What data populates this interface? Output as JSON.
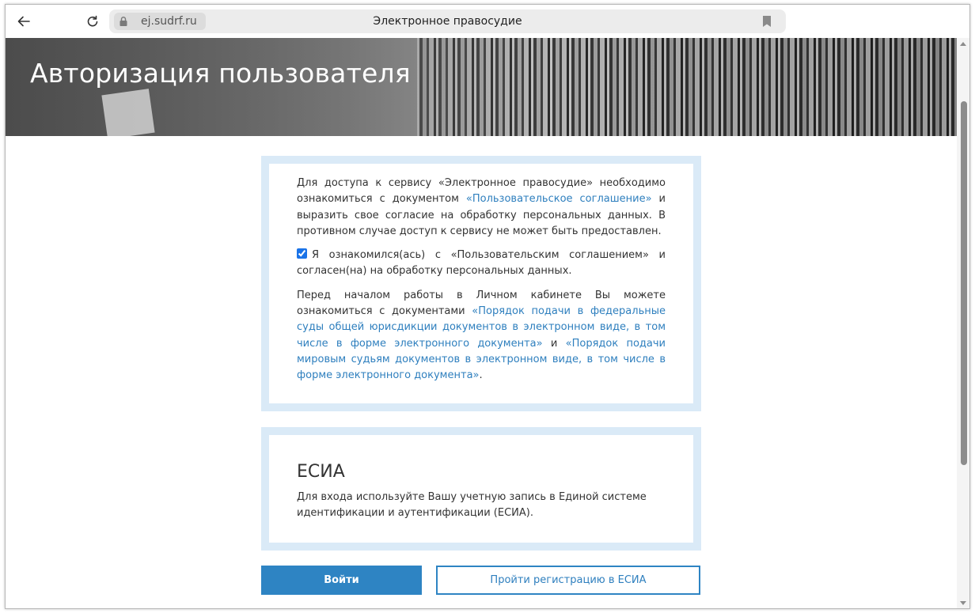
{
  "browser": {
    "domain": "ej.sudrf.ru",
    "tab_title": "Электронное правосудие"
  },
  "hero": {
    "title": "Авторизация пользователя"
  },
  "agreement": {
    "p1_part1": "Для доступа к сервису «Электронное правосудие» необходимо ознакомиться с документом ",
    "p1_link": "«Пользовательское соглашение»",
    "p1_part2": " и выразить свое согласие на обработку персональных данных. В противном случае доступ к сервису не может быть предоставлен.",
    "checkbox_label": "Я ознакомился(ась) с «Пользовательским соглашением» и согласен(на) на обработку персональных данных.",
    "checkbox_checked": true,
    "p2_part1": "Перед началом работы в Личном кабинете Вы можете ознакомиться с документами ",
    "p2_link1": "«Порядок подачи в федеральные суды общей юрисдикции документов в электронном виде, в том числе в форме электронного документа»",
    "p2_mid": " и ",
    "p2_link2": "«Порядок подачи мировым судьям документов в электронном виде, в том числе в форме электронного документа»",
    "p2_end": "."
  },
  "esia": {
    "title": "ЕСИА",
    "description": "Для входа используйте Вашу учетную запись в Единой системе идентификации и аутентификации (ЕСИА)."
  },
  "actions": {
    "login_label": "Войти",
    "register_label": "Пройти регистрацию в ЕСИА"
  },
  "colors": {
    "accent": "#2e84c3",
    "link": "#2e7fbe",
    "panel_border": "#daeaf7"
  }
}
